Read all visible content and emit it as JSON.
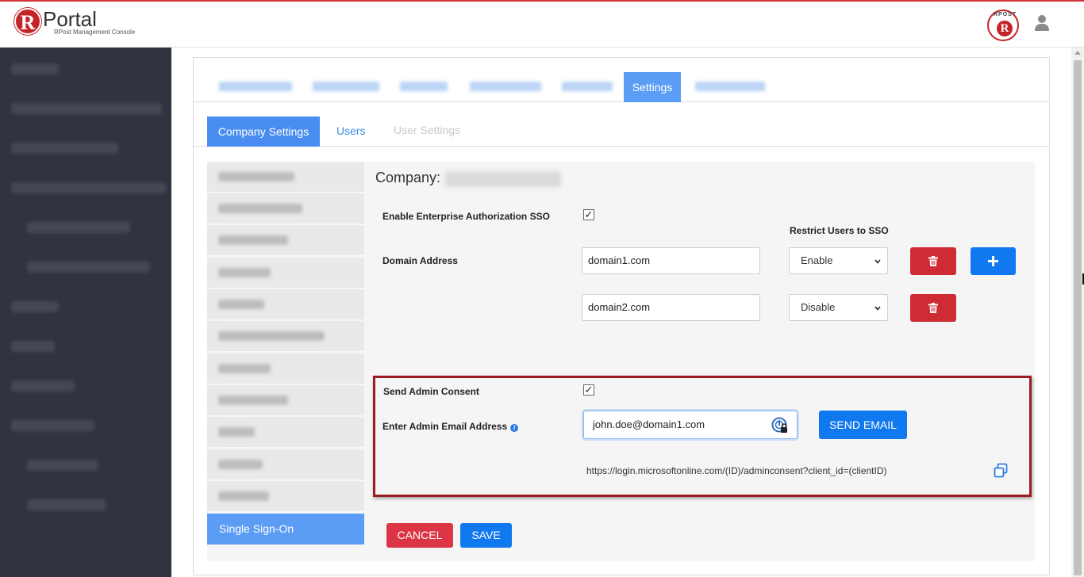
{
  "header": {
    "logo_letter": "R",
    "logo_name": "Portal",
    "logo_subtitle": "RPost Management Console",
    "badge_arc": "RPOST",
    "badge_letter": "R"
  },
  "top_tabs": {
    "active": "Settings"
  },
  "sub_tabs": {
    "company_settings": "Company Settings",
    "users": "Users",
    "user_settings": "User Settings"
  },
  "settings_menu": {
    "active": "Single Sign-On"
  },
  "company": {
    "label": "Company:"
  },
  "sso": {
    "enable_label": "Enable Enterprise Authorization SSO",
    "enable_checked": "✓",
    "restrict_label": "Restrict Users to SSO",
    "domain_label": "Domain Address",
    "domains": [
      {
        "value": "domain1.com",
        "restrict": "Enable"
      },
      {
        "value": "domain2.com",
        "restrict": "Disable"
      }
    ]
  },
  "admin_consent": {
    "send_label": "Send Admin Consent",
    "send_checked": "✓",
    "email_label": "Enter Admin Email Address",
    "email_value": "john.doe@domain1.com",
    "send_button": "SEND EMAIL",
    "url": "https://login.microsoftonline.com/(ID)/adminconsent?client_id=(clientID)"
  },
  "actions": {
    "cancel": "CANCEL",
    "save": "SAVE"
  },
  "colors": {
    "primary": "#1079f0",
    "danger": "#cf2b34",
    "tab_active": "#5b9cf5",
    "sidebar": "#2f3440",
    "highlight": "#9c1c20"
  }
}
